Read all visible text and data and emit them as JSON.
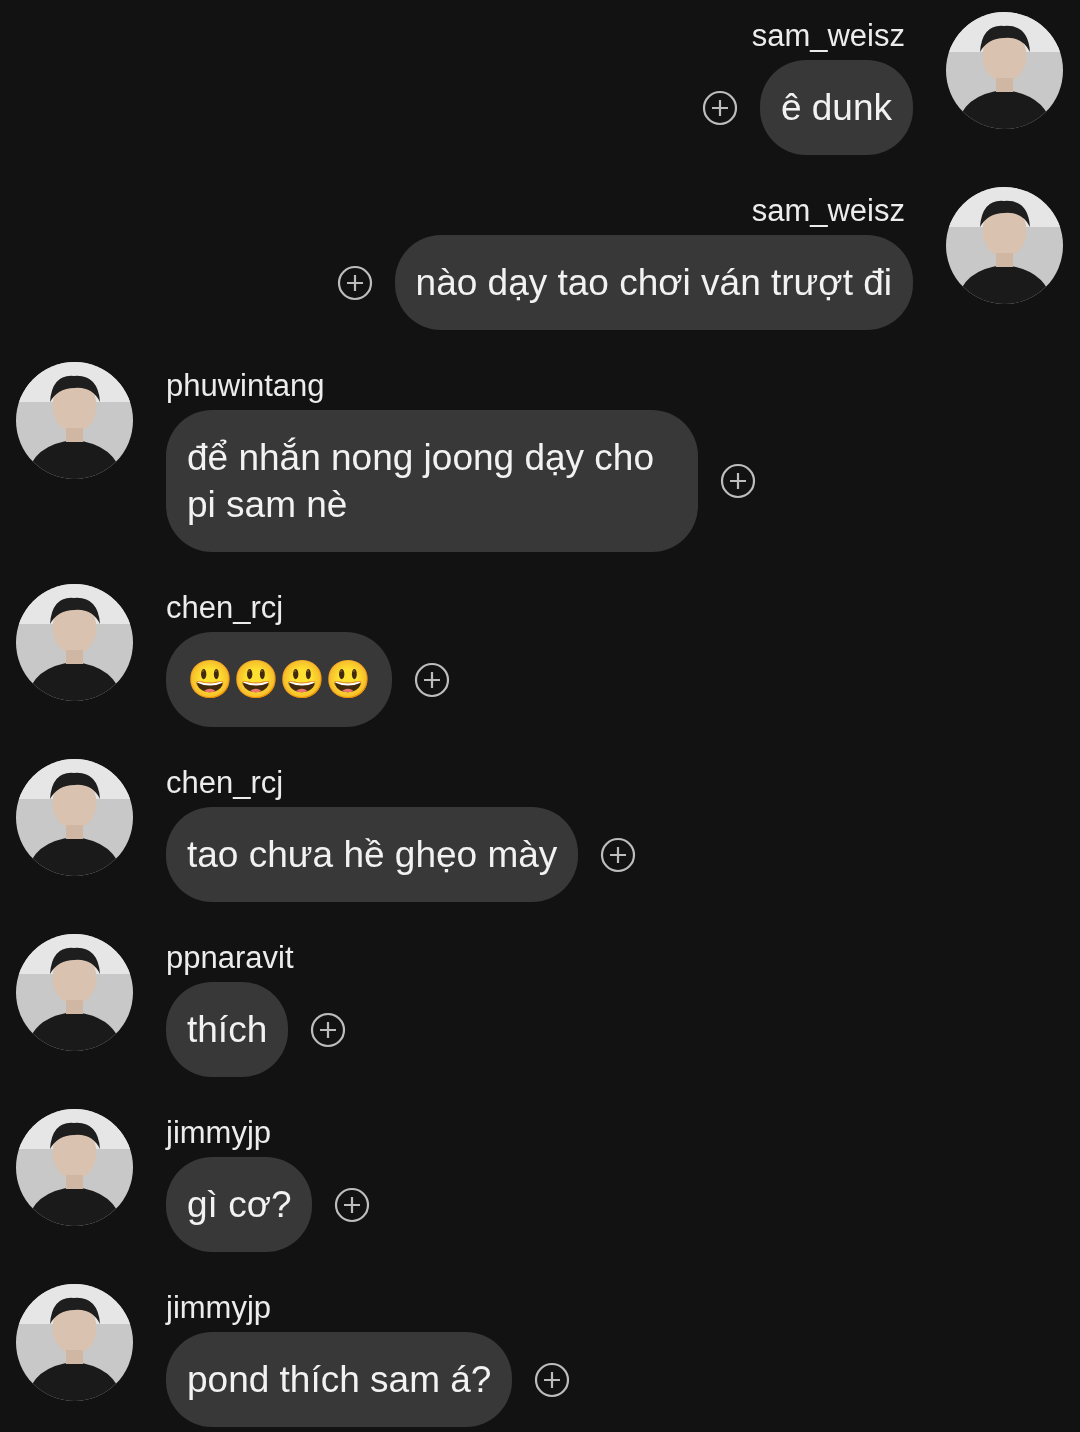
{
  "messages": [
    {
      "kind": "sent",
      "username": "sam_weisz",
      "text": "ê dunk"
    },
    {
      "kind": "sent",
      "username": "sam_weisz",
      "text": "nào dạy tao chơi ván trượt đi"
    },
    {
      "kind": "received",
      "username": "phuwintang",
      "text": "để nhắn nong joong dạy cho pi sam nè"
    },
    {
      "kind": "received",
      "username": "chen_rcj",
      "text": "😃😃😃😃"
    },
    {
      "kind": "received",
      "username": "chen_rcj",
      "text": "tao chưa hề ghẹo mày"
    },
    {
      "kind": "received",
      "username": "ppnaravit",
      "text": "thích"
    },
    {
      "kind": "received",
      "username": "jimmyjp",
      "text": "gì cơ?"
    },
    {
      "kind": "received",
      "username": "jimmyjp",
      "text": "pond thích sam á?"
    }
  ]
}
